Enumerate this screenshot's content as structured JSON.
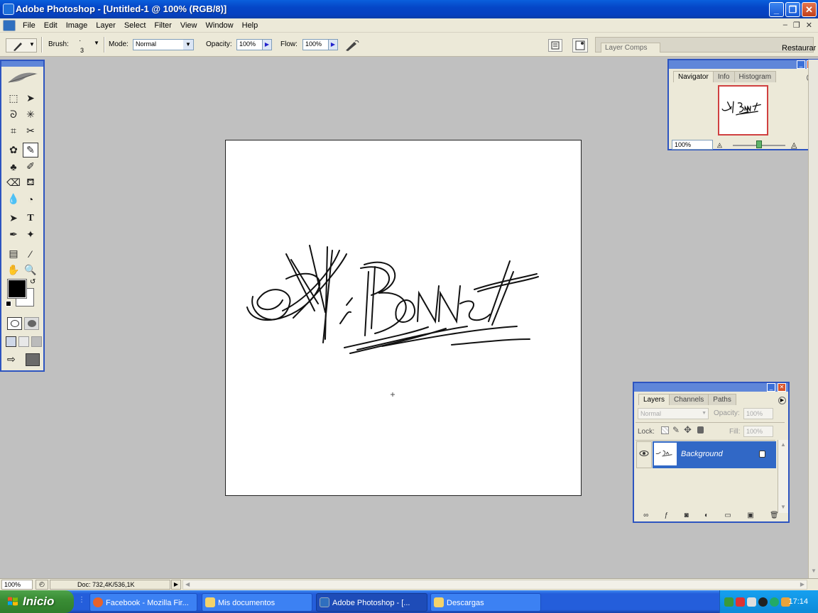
{
  "window": {
    "title": "Adobe Photoshop - [Untitled-1 @ 100% (RGB/8)]",
    "minimize": "_",
    "restore": "❐",
    "close": "✕"
  },
  "menubar": {
    "items": [
      "File",
      "Edit",
      "Image",
      "Layer",
      "Select",
      "Filter",
      "View",
      "Window",
      "Help"
    ],
    "doc_controls": [
      "–",
      "❐",
      "✕"
    ]
  },
  "options": {
    "brush_label": "Brush:",
    "brush_size": "3",
    "mode_label": "Mode:",
    "mode_value": "Normal",
    "opacity_label": "Opacity:",
    "opacity_value": "100%",
    "flow_label": "Flow:",
    "flow_value": "100%",
    "layer_comps_tab": "Layer Comps",
    "restaurar": "Restaurar"
  },
  "navigator": {
    "tabs": [
      "Navigator",
      "Info",
      "Histogram"
    ],
    "zoom": "100%",
    "zoom_slider_fraction": 0.5
  },
  "layers": {
    "tabs": [
      "Layers",
      "Channels",
      "Paths"
    ],
    "blend_mode": "Normal",
    "opacity_label": "Opacity:",
    "opacity_value": "100%",
    "lock_label": "Lock:",
    "fill_label": "Fill:",
    "fill_value": "100%",
    "layer_name": "Background"
  },
  "status": {
    "zoom": "100%",
    "doc": "Doc: 732,4K/536,1K"
  },
  "taskbar": {
    "start": "Inicio",
    "tasks": [
      {
        "label": "Facebook - Mozilla Fir...",
        "icon_color": "#e8632b",
        "active": false
      },
      {
        "label": "Mis documentos",
        "icon_color": "#f4d36a",
        "active": false
      },
      {
        "label": "Adobe Photoshop - [...",
        "icon_color": "#2f6fbf",
        "active": true
      },
      {
        "label": "Descargas",
        "icon_color": "#f4d36a",
        "active": false
      }
    ],
    "clock": "17:14"
  },
  "colors": {
    "titlebar": "#0a5fdc",
    "selection": "#3168c6",
    "workspace": "#c0c0c0",
    "taskbar": "#245edb",
    "start": "#3a8d35"
  }
}
